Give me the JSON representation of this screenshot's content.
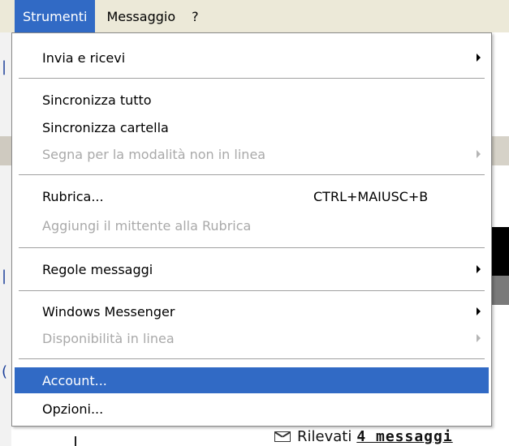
{
  "menubar": {
    "items": [
      {
        "label": "Strumenti"
      },
      {
        "label": "Messaggio"
      },
      {
        "label": "?"
      }
    ]
  },
  "dropdown": {
    "items": [
      {
        "label": "Invia e ricevi",
        "enabled": true,
        "submenu": true
      },
      {
        "label": "Sincronizza tutto",
        "enabled": true
      },
      {
        "label": "Sincronizza cartella",
        "enabled": true
      },
      {
        "label": "Segna per la modalità non in linea",
        "enabled": false,
        "submenu": true
      },
      {
        "label": "Rubrica...",
        "shortcut": "CTRL+MAIUSC+B",
        "enabled": true
      },
      {
        "label": "Aggiungi il mittente alla Rubrica",
        "enabled": false
      },
      {
        "label": "Regole messaggi",
        "enabled": true,
        "submenu": true
      },
      {
        "label": "Windows Messenger",
        "enabled": true,
        "submenu": true
      },
      {
        "label": "Disponibilità in linea",
        "enabled": false,
        "submenu": true
      },
      {
        "label": "Account...",
        "enabled": true,
        "highlighted": true
      },
      {
        "label": "Opzioni...",
        "enabled": true
      }
    ]
  },
  "status": {
    "icon": "envelope-icon",
    "text": "Rilevati",
    "count": "4 messaggi"
  },
  "colors": {
    "highlight": "#316ac5",
    "menubar_bg": "#ece9d8",
    "disabled_text": "#a9a9a9"
  }
}
